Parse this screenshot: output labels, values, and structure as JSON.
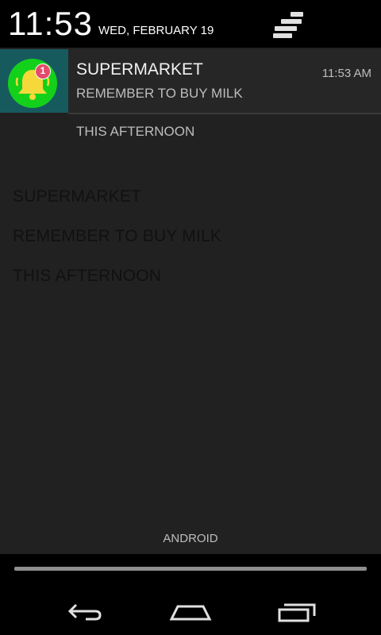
{
  "status": {
    "time": "11:53",
    "date": "WED, FEBRUARY 19"
  },
  "notification": {
    "icon": "bell-icon",
    "badge": "1",
    "title": "SUPERMARKET",
    "time": "11:53 AM",
    "text": "REMEMBER TO BUY MILK",
    "subtext": "THIS AFTERNOON"
  },
  "background": {
    "lines": [
      "SUPERMARKET",
      "REMEMBER TO BUY MILK",
      "THIS AFTERNOON"
    ]
  },
  "carrier": "ANDROID",
  "colors": {
    "shade_bg": "#212121",
    "header_bg": "#000000",
    "icon_bg": "#175a5e",
    "icon_circle": "#13d11b",
    "bell": "#f7d83a",
    "badge": "#e64a6a"
  },
  "nav": {
    "back": "back-icon",
    "home": "home-icon",
    "recents": "recents-icon"
  }
}
